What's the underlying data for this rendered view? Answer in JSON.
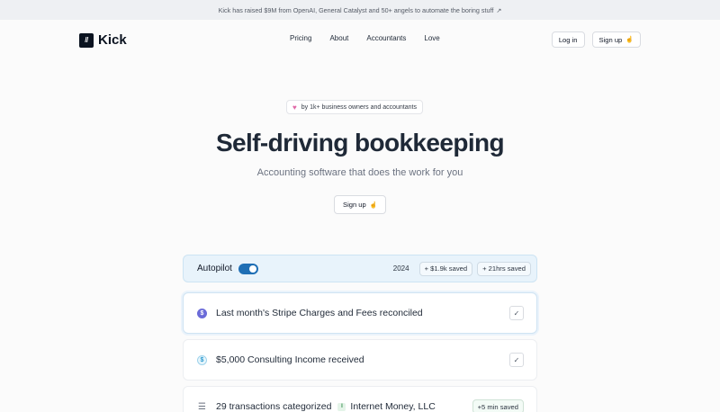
{
  "banner": {
    "text": "Kick has raised $9M from OpenAI, General Catalyst and 50+ angels to automate the boring stuff",
    "arrow": "↗"
  },
  "header": {
    "logo_mark": "//",
    "logo_text": "Kick",
    "nav": [
      "Pricing",
      "About",
      "Accountants",
      "Love"
    ],
    "login_label": "Log in",
    "signup_label": "Sign up",
    "signup_icon": "hand-wave-icon"
  },
  "hero": {
    "pill_text": "by 1k+ business owners and accountants",
    "title": "Self-driving bookkeeping",
    "subtitle": "Accounting software that does the work for you",
    "cta_label": "Sign up"
  },
  "autopilot": {
    "label": "Autopilot",
    "toggle_on": true,
    "year": "2024",
    "saved_money": "+ $1.9k saved",
    "saved_time": "+ 21hrs saved"
  },
  "items": [
    {
      "icon": "stripe-icon",
      "text": "Last month's Stripe Charges and Fees reconciled",
      "status": "✓"
    },
    {
      "icon": "dollar-icon",
      "text": "$5,000 Consulting Income received",
      "status": "✓"
    },
    {
      "icon": "list-icon",
      "text": "29 transactions categorized",
      "tag": "I",
      "tag_text": "Internet Money, LLC",
      "badge": "+5 min saved"
    }
  ],
  "colors": {
    "accent": "#1f6fb5",
    "autopilot_bg": "#e8f3fb",
    "heart": "#e06aa8"
  }
}
